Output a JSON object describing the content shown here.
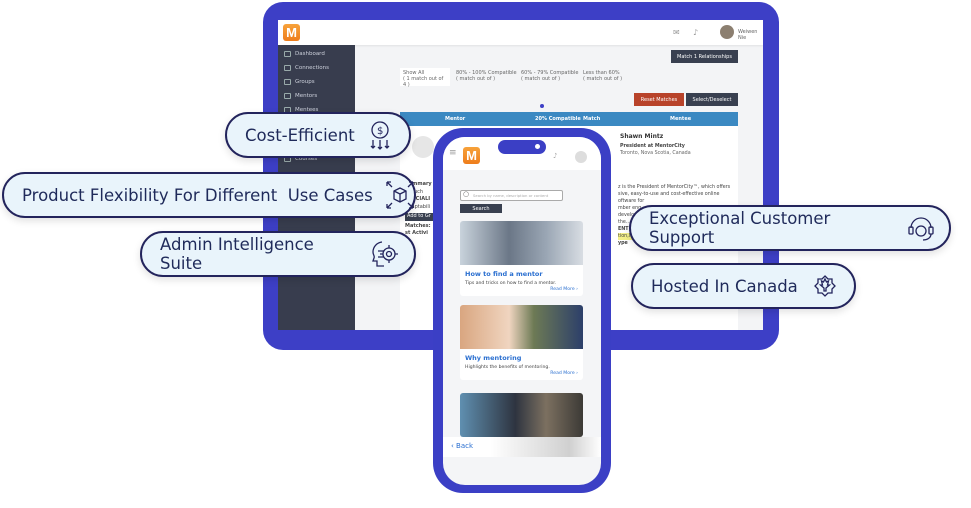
{
  "desktop": {
    "user_name": "Weiwen Nie",
    "sidebar": [
      "Dashboard",
      "Connections",
      "Groups",
      "Mentors",
      "Mentees",
      "Courses"
    ],
    "match_button": "Match 1 Relationships",
    "filters": [
      {
        "label": "Show All",
        "sub": "( 1 match out of 4 )"
      },
      {
        "label": "80% - 100% Compatible",
        "sub": "( match out of )"
      },
      {
        "label": "60% - 79% Compatible",
        "sub": "( match out of )"
      },
      {
        "label": "Less than 60%",
        "sub": "( match out of )"
      }
    ],
    "reset_button": "Reset Matches",
    "select_button": "Select/Deselect",
    "table_headers": {
      "mentor": "Mentor",
      "compat": "20% Compatible",
      "match": "Match",
      "mentee": "Mentee"
    },
    "mentee": {
      "name": "Shawn Mintz",
      "title": "President at MentorCity",
      "location": "Toronto, Nova Scotia, Canada"
    },
    "left_fragments": [
      "Summary",
      "o Much",
      "SPECIALI",
      "Adaptabili",
      "Add to Gr",
      "Matches:",
      "st Activi"
    ],
    "bio_lines": [
      "z is the President of MentorCity™, which offers",
      "sive, easy-to-use and cost-effective online",
      "oftware for",
      "mber eng",
      "develop",
      "the...",
      "ENT AR",
      "tion,Innova",
      "ype"
    ]
  },
  "mobile": {
    "search_placeholder": "Search by name, description or content",
    "search_button": "Search",
    "cards": [
      {
        "title": "How to find a mentor",
        "desc": "Tips and tricks on how to find a mentor.",
        "more": "Read More ›"
      },
      {
        "title": "Why mentoring",
        "desc": "Highlights the benefits of mentoring.",
        "more": "Read More ›"
      }
    ],
    "back": "Back"
  },
  "features": [
    "Cost-Efficient",
    "Product Flexibility For Different  Use Cases",
    "Admin Intelligence Suite",
    "Exceptional Customer Support",
    "Hosted In Canada"
  ],
  "colors": {
    "frame": "#3d3fc6",
    "pill_bg": "#e9f4fb",
    "pill_border": "#23245c",
    "table_header": "#3b89c2",
    "reset": "#b8432a",
    "dark_button": "#394050",
    "logo": "#f39430"
  }
}
